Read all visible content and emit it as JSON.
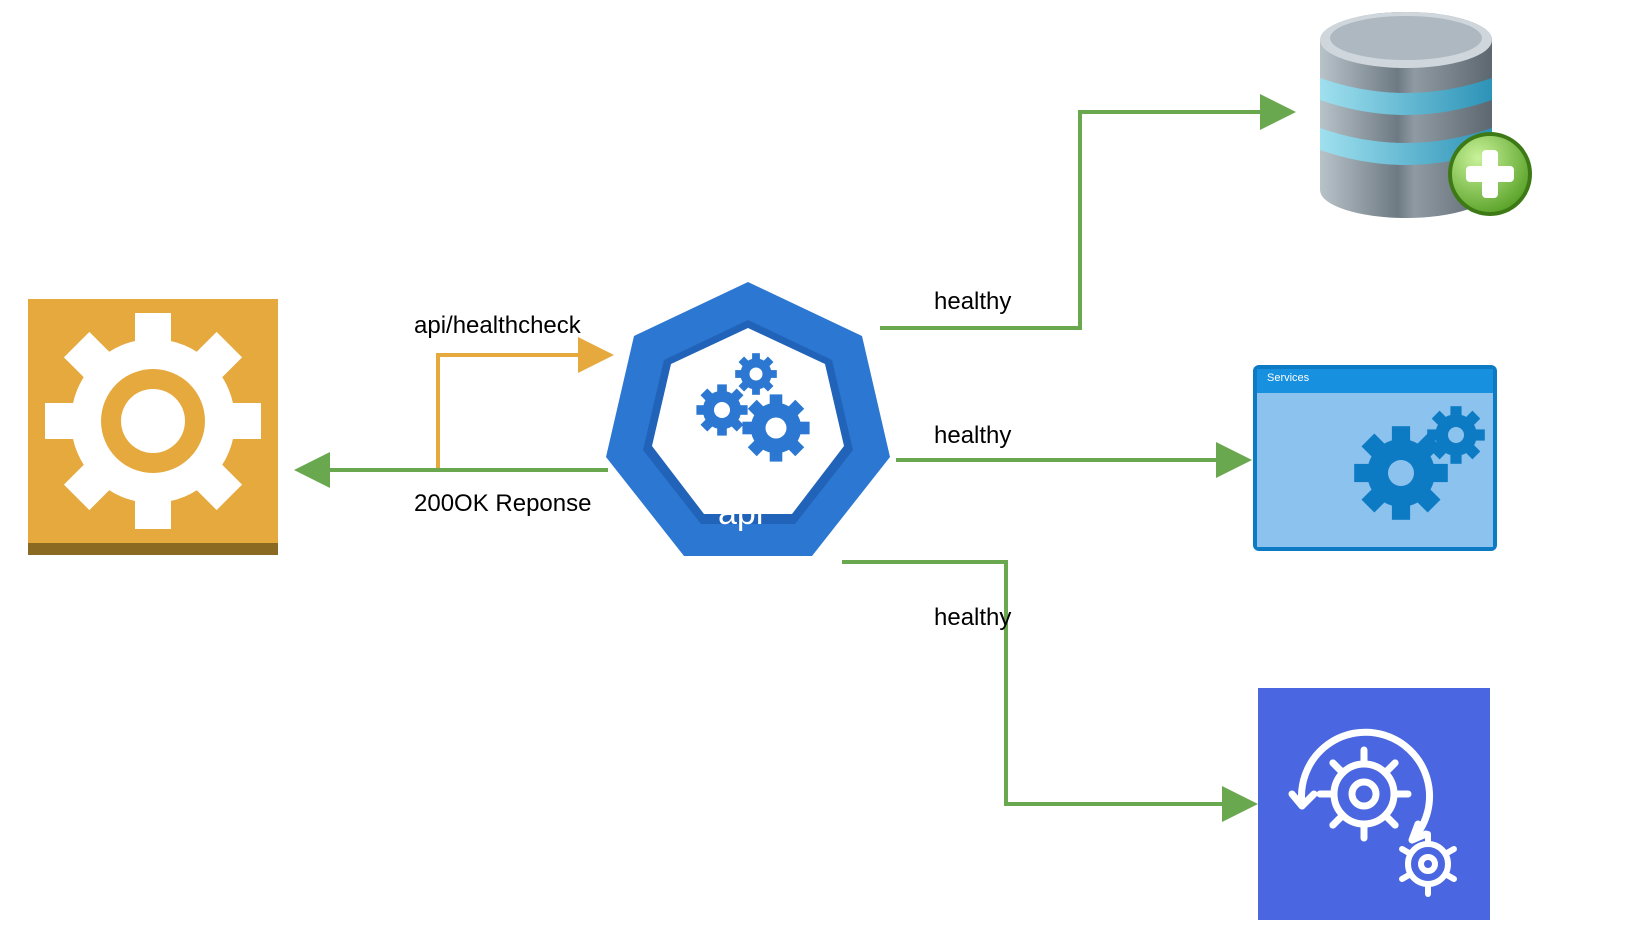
{
  "nodes": {
    "caller": {
      "type": "gear-service",
      "color_fill": "#e6a93d",
      "color_accent": "#8a6a22"
    },
    "api": {
      "type": "kubernetes-api",
      "label": "api",
      "color_fill": "#2b77d1",
      "color_deep": "#2163b8"
    },
    "db": {
      "type": "database-plus",
      "color_body": "#8f9aa3",
      "color_band": "#57b7d6",
      "plus_fill": "#7fc641"
    },
    "svc": {
      "type": "services-window",
      "title": "Services",
      "color_frame": "#0d7bc4",
      "color_body": "#8cc2ee"
    },
    "ops": {
      "type": "ops-cycle",
      "color_fill": "#4a66e0"
    }
  },
  "edges": {
    "request": {
      "label": "api/healthcheck",
      "color": "#e6a93d"
    },
    "response": {
      "label": "200OK Reponse",
      "color": "#6aa84f"
    },
    "to_db": {
      "label": "healthy",
      "color": "#6aa84f"
    },
    "to_svc": {
      "label": "healthy",
      "color": "#6aa84f"
    },
    "to_ops": {
      "label": "healthy",
      "color": "#6aa84f"
    }
  }
}
